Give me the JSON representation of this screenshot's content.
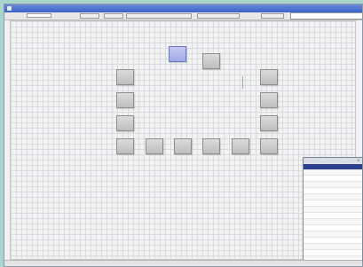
{
  "window": {
    "title": "",
    "titlebar_color": "#3b62c8"
  },
  "toolbar": {
    "label": "",
    "button_1": "",
    "button_2": "",
    "button_3": "",
    "button_4": "",
    "button_5": "",
    "search_value": ""
  },
  "canvas": {
    "nodes": [
      {
        "id": "top-selected",
        "label": "",
        "selected": true
      },
      {
        "id": "top-right",
        "label": ""
      },
      {
        "id": "left-1",
        "label": ""
      },
      {
        "id": "left-2",
        "label": ""
      },
      {
        "id": "left-3",
        "label": ""
      },
      {
        "id": "left-4",
        "label": ""
      },
      {
        "id": "bottom-1",
        "label": ""
      },
      {
        "id": "bottom-2",
        "label": ""
      },
      {
        "id": "bottom-3",
        "label": ""
      },
      {
        "id": "bottom-4",
        "label": ""
      },
      {
        "id": "bottom-5",
        "label": ""
      },
      {
        "id": "right-1",
        "label": ""
      },
      {
        "id": "right-2",
        "label": ""
      },
      {
        "id": "right-3",
        "label": ""
      },
      {
        "id": "right-4",
        "label": ""
      }
    ],
    "grid_color": "#d8dbe0",
    "node_color": "#bdbdbd",
    "selected_node_color": "#9fa9e6"
  },
  "properties_panel": {
    "title": "",
    "header_color": "#2f3f8f",
    "col_key": "",
    "col_value": "",
    "rows": [
      {
        "k": "",
        "v": ""
      },
      {
        "k": "",
        "v": ""
      },
      {
        "k": "",
        "v": ""
      },
      {
        "k": "",
        "v": ""
      },
      {
        "k": "",
        "v": ""
      },
      {
        "k": "",
        "v": ""
      },
      {
        "k": "",
        "v": ""
      },
      {
        "k": "",
        "v": ""
      },
      {
        "k": "",
        "v": ""
      },
      {
        "k": "",
        "v": ""
      },
      {
        "k": "",
        "v": ""
      },
      {
        "k": "",
        "v": ""
      },
      {
        "k": "",
        "v": ""
      },
      {
        "k": "",
        "v": ""
      },
      {
        "k": "",
        "v": ""
      }
    ]
  },
  "statusbar": {
    "text": ""
  }
}
